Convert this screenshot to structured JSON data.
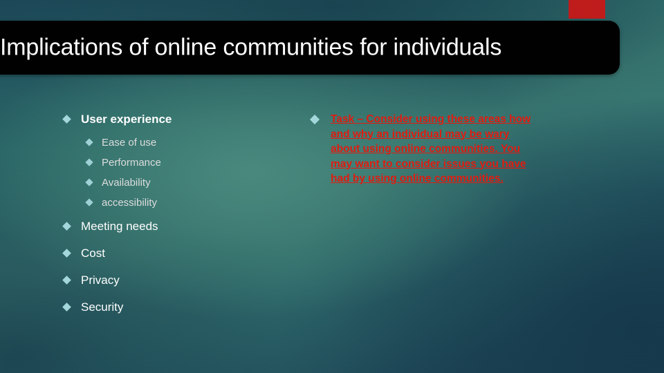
{
  "slide": {
    "title": "Implications of online communities for individuals",
    "accent_color": "#bf1b1b",
    "title_bar_color": "#000000",
    "title_text_color": "#ffffff",
    "bullet_color": "#a4d8dc",
    "task_text_color": "#e01b10",
    "background_colors": [
      "#1d4a5b",
      "#3c7d74",
      "#183a4a"
    ]
  },
  "left_column": {
    "items": [
      {
        "label": "User experience",
        "level": 1,
        "bold": true
      },
      {
        "label": "Ease of use",
        "level": 2,
        "bold": false
      },
      {
        "label": "Performance",
        "level": 2,
        "bold": false
      },
      {
        "label": "Availability",
        "level": 2,
        "bold": false
      },
      {
        "label": "accessibility",
        "level": 2,
        "bold": false
      },
      {
        "label": "Meeting needs",
        "level": 1,
        "bold": false
      },
      {
        "label": "Cost",
        "level": 1,
        "bold": false
      },
      {
        "label": "Privacy",
        "level": 1,
        "bold": false
      },
      {
        "label": "Security",
        "level": 1,
        "bold": false
      }
    ]
  },
  "right_column": {
    "task": "Task – Consider using these areas how and why an individual may be wary about using online communities. You may want to consider issues you have had by using online communities."
  }
}
